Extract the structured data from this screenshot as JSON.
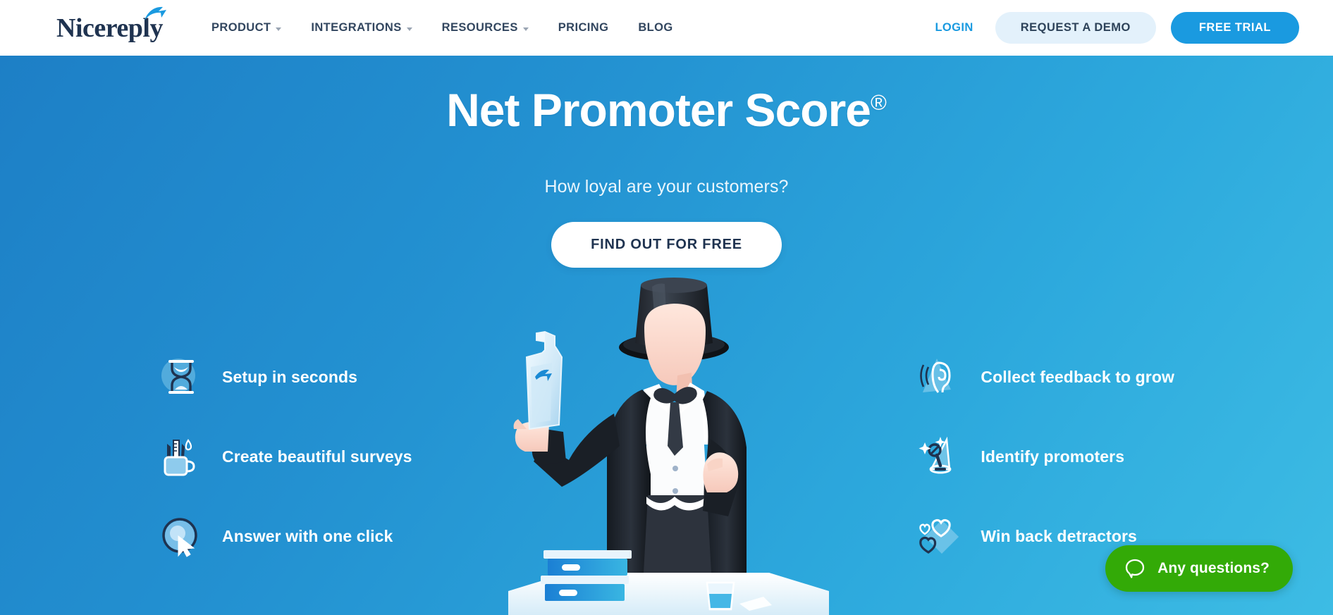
{
  "header": {
    "logo": {
      "text": "Nicereply",
      "icon": "arrow-swoosh-icon"
    },
    "nav": [
      {
        "label": "PRODUCT",
        "has_dropdown": true
      },
      {
        "label": "INTEGRATIONS",
        "has_dropdown": true
      },
      {
        "label": "RESOURCES",
        "has_dropdown": true
      },
      {
        "label": "PRICING",
        "has_dropdown": false
      },
      {
        "label": "BLOG",
        "has_dropdown": false
      }
    ],
    "login_label": "LOGIN",
    "demo_label": "REQUEST A DEMO",
    "trial_label": "FREE TRIAL"
  },
  "hero": {
    "title": "Net Promoter Score",
    "title_mark": "®",
    "subtitle": "How loyal are your customers?",
    "cta_label": "FIND OUT FOR FREE"
  },
  "features_left": [
    {
      "label": "Setup in seconds",
      "icon": "hourglass-icon"
    },
    {
      "label": "Create beautiful surveys",
      "icon": "pen-mug-icon"
    },
    {
      "label": "Answer with one click",
      "icon": "cursor-click-icon"
    }
  ],
  "features_right": [
    {
      "label": "Collect feedback to grow",
      "icon": "listening-ear-icon"
    },
    {
      "label": "Identify promoters",
      "icon": "spotlight-magnifier-icon"
    },
    {
      "label": "Win back detractors",
      "icon": "hearts-icon"
    }
  ],
  "chat": {
    "label": "Any questions?",
    "icon": "chat-bubble-icon"
  },
  "illustration": {
    "name": "salesman-with-bottle-illustration"
  },
  "colors": {
    "brand_blue": "#1a9ae0",
    "navy": "#1f3350",
    "hero_gradient_start": "#1d7fc6",
    "hero_gradient_end": "#3dbce4",
    "demo_button_bg": "#e3f1fb",
    "chat_green": "#33aa07",
    "white": "#ffffff"
  }
}
